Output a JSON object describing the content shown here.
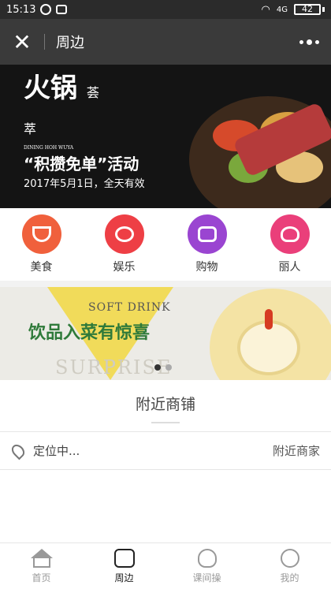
{
  "status_bar": {
    "time": "15:13",
    "signal_label": "4G",
    "battery": "42"
  },
  "header": {
    "title": "周边"
  },
  "banner_top": {
    "brand_main": "火锅",
    "brand_sub": "荟萃",
    "brand_en": "DINING HOH WUYA",
    "headline": "“积攒免单”活动",
    "date_line": "2017年5月1日，全天有效"
  },
  "categories": [
    {
      "label": "美食",
      "color": "#f0603c",
      "icon": "rice-bowl-icon"
    },
    {
      "label": "娱乐",
      "color": "#ee3f45",
      "icon": "film-reel-icon"
    },
    {
      "label": "购物",
      "color": "#9a45d1",
      "icon": "shopping-bag-icon"
    },
    {
      "label": "丽人",
      "color": "#ea3f7a",
      "icon": "woman-face-icon"
    }
  ],
  "banner_second": {
    "tag": "SOFT DRINK",
    "slogan": "饮品入菜有惊喜",
    "watermark": "SURPRISE"
  },
  "section": {
    "title": "附近商铺"
  },
  "location": {
    "status": "定位中...",
    "nearby_link": "附近商家"
  },
  "tabs": [
    {
      "label": "首页",
      "icon": "home-icon"
    },
    {
      "label": "周边",
      "icon": "shop-icon",
      "active": true
    },
    {
      "label": "课间操",
      "icon": "flower-icon"
    },
    {
      "label": "我的",
      "icon": "person-face-icon"
    }
  ]
}
